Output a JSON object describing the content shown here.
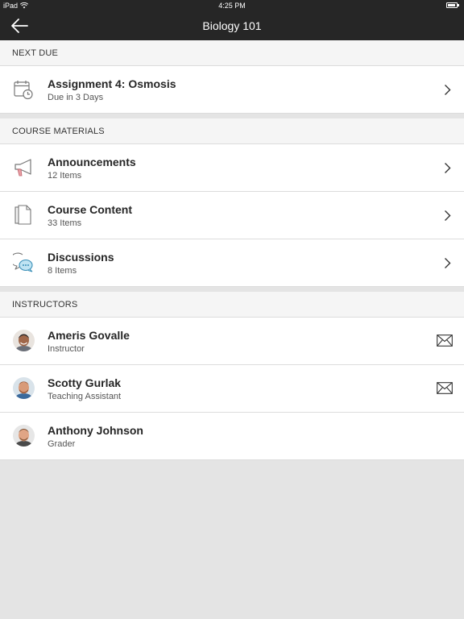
{
  "statusbar": {
    "device": "iPad",
    "time": "4:25 PM",
    "battery_level": 0.9
  },
  "navbar": {
    "title": "Biology 101",
    "back_icon": "arrow-left-icon"
  },
  "next_due": {
    "header": "NEXT DUE",
    "item": {
      "title": "Assignment 4: Osmosis",
      "subtitle": "Due in 3 Days",
      "icon": "calendar-clock-icon"
    }
  },
  "course_materials": {
    "header": "COURSE MATERIALS",
    "items": [
      {
        "title": "Announcements",
        "subtitle": "12 Items",
        "icon": "megaphone-icon"
      },
      {
        "title": "Course Content",
        "subtitle": "33 Items",
        "icon": "document-icon"
      },
      {
        "title": "Discussions",
        "subtitle": "8 Items",
        "icon": "chat-bubbles-icon"
      }
    ]
  },
  "instructors": {
    "header": "INSTRUCTORS",
    "people": [
      {
        "name": "Ameris Govalle",
        "role": "Instructor",
        "mail": true
      },
      {
        "name": "Scotty Gurlak",
        "role": "Teaching Assistant",
        "mail": true
      },
      {
        "name": "Anthony Johnson",
        "role": "Grader",
        "mail": false
      }
    ]
  },
  "colors": {
    "nav_bg": "#262626",
    "accent": "#3a8fb7",
    "page_bg": "#e4e4e4"
  }
}
